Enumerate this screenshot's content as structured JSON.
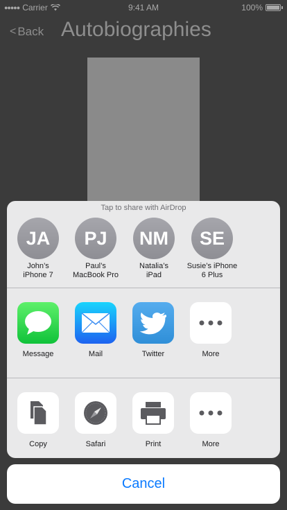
{
  "status_bar": {
    "carrier": "Carrier",
    "time": "9:41 AM",
    "battery": "100%"
  },
  "nav": {
    "back_label": "Back",
    "title": "Autobiographies"
  },
  "share_sheet": {
    "airdrop_hint": "Tap to share with AirDrop",
    "contacts": [
      {
        "initials": "JA",
        "name": "John’s\niPhone 7"
      },
      {
        "initials": "PJ",
        "name": "Paul’s\nMacBook Pro"
      },
      {
        "initials": "NM",
        "name": "Natalia’s\niPad"
      },
      {
        "initials": "SE",
        "name": "Susie’s iPhone\n6 Plus"
      }
    ],
    "share_apps": [
      {
        "label": "Message",
        "icon": "message-icon"
      },
      {
        "label": "Mail",
        "icon": "mail-icon"
      },
      {
        "label": "Twitter",
        "icon": "twitter-icon"
      },
      {
        "label": "More",
        "icon": "more-icon"
      }
    ],
    "actions": [
      {
        "label": "Copy",
        "icon": "copy-icon"
      },
      {
        "label": "Safari",
        "icon": "safari-icon"
      },
      {
        "label": "Print",
        "icon": "print-icon"
      },
      {
        "label": "More",
        "icon": "more-icon"
      }
    ],
    "cancel_label": "Cancel"
  },
  "colors": {
    "accent": "#0a7aff",
    "message_green": "#4cd964",
    "mail_blue": "#1d9bf6",
    "twitter_blue": "#2f8fd8"
  }
}
